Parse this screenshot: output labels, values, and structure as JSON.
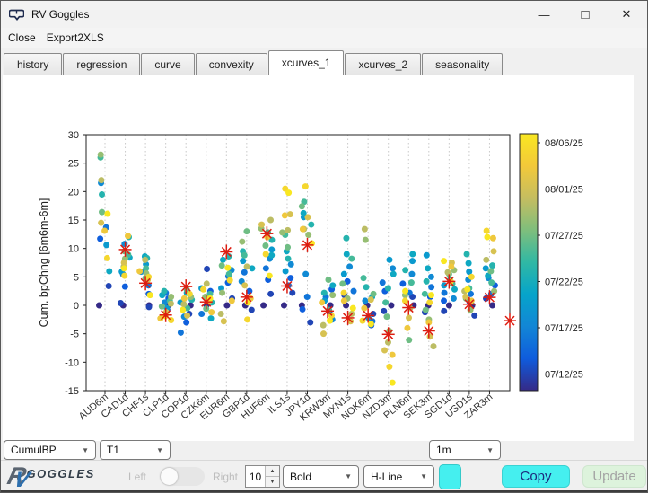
{
  "window": {
    "title": "RV Goggles",
    "controls": {
      "minimize": "—",
      "maximize": "□",
      "close": "✕"
    }
  },
  "menu": {
    "items": [
      {
        "label": "Close"
      },
      {
        "label": "Export2XLS"
      }
    ]
  },
  "tabs": {
    "selected": "xcurves_1",
    "items": [
      {
        "label": "history"
      },
      {
        "label": "regression"
      },
      {
        "label": "curve"
      },
      {
        "label": "convexity"
      },
      {
        "label": "xcurves_1"
      },
      {
        "label": "xcurves_2"
      },
      {
        "label": "seasonality"
      }
    ]
  },
  "chart_data": {
    "type": "scatter",
    "ylabel": "Cum. bpChng [6m6m-6m]",
    "ylim": [
      -15,
      30
    ],
    "yticks": [
      -15,
      -10,
      -5,
      0,
      5,
      10,
      15,
      20,
      25,
      30
    ],
    "grid": "vertical-dotted",
    "categories": [
      "AUD6m",
      "CAD1d",
      "CHF1s",
      "CLP1d",
      "COP1d",
      "CZK6m",
      "EUR6m",
      "GBP1d",
      "HUF6m",
      "ILS1s",
      "JPY1d",
      "KRW3m",
      "MXN1s",
      "NOK6m",
      "NZD3m",
      "PLN6m",
      "SEK3m",
      "SGD1d",
      "USD1s",
      "ZAR3m"
    ],
    "colorbar": {
      "tick_labels": [
        "08/06/25",
        "08/01/25",
        "07/27/25",
        "07/22/25",
        "07/17/25",
        "07/12/25"
      ],
      "colormap": "parula",
      "top_color": "#f9e721",
      "bottom_color": "#352a87"
    },
    "series_note": "values per category are chronological 07/12/25 (dark blue) to 08/06/25 (yellow)",
    "series": [
      {
        "name": "AUD6m",
        "values": [
          0,
          3.4,
          11.7,
          13.7,
          21.5,
          10.6,
          6.0,
          19.5,
          26.0,
          16.4,
          26.5,
          22.0,
          14.5,
          13.1,
          8.3,
          16.1
        ]
      },
      {
        "name": "CAD1d",
        "values": [
          0,
          0.4,
          3.3,
          5.4,
          10.8,
          5.9,
          8.4,
          12.0,
          8.9,
          9.5,
          8.2,
          6.8,
          7.5,
          12.2,
          5.2,
          6.5
        ]
      },
      {
        "name": "CHF1s",
        "values": [
          0,
          -0.3,
          2.0,
          3.5,
          5.9,
          7.2,
          8.6,
          8.3,
          6.5,
          4.8,
          5.6,
          8.0,
          4.5,
          6.0,
          5.0,
          1.8
        ]
      },
      {
        "name": "CLP1d",
        "values": [
          0,
          -0.8,
          1.2,
          2.2,
          0.5,
          -0.5,
          1.8,
          2.5,
          0.8,
          -0.2,
          1.5,
          0.3,
          -1.2,
          -2.3,
          -2.6,
          -1.9
        ]
      },
      {
        "name": "COP1d",
        "values": [
          0,
          -1.5,
          -3.0,
          -4.8,
          -2.0,
          0.5,
          2.2,
          1.0,
          -0.5,
          2.8,
          1.5,
          0.2,
          -1.8,
          1.2,
          2.0,
          -0.8
        ]
      },
      {
        "name": "CZK6m",
        "values": [
          0,
          6.4,
          2.5,
          -1.5,
          1.0,
          3.0,
          -2.3,
          0.5,
          2.0,
          -0.6,
          1.5,
          3.8,
          0.8,
          -1.2,
          2.8,
          1.2
        ]
      },
      {
        "name": "EUR6m",
        "values": [
          0,
          1.2,
          4.0,
          5.1,
          6.2,
          3.0,
          8.0,
          8.6,
          5.5,
          7.0,
          2.2,
          -1.5,
          -2.8,
          0.8,
          4.4,
          6.6
        ]
      },
      {
        "name": "GBP1d",
        "values": [
          0,
          -0.8,
          2.5,
          5.8,
          4.2,
          7.8,
          6.5,
          9.5,
          8.8,
          13.0,
          11.2,
          6.8,
          3.5,
          1.2,
          -2.5,
          0.5
        ]
      },
      {
        "name": "HUF6m",
        "values": [
          0,
          2.0,
          4.5,
          6.5,
          8.2,
          9.8,
          8.8,
          11.5,
          12.8,
          10.5,
          13.5,
          15.0,
          14.2,
          12.0,
          9.0,
          5.2
        ]
      },
      {
        "name": "ILS1s",
        "values": [
          0,
          2.2,
          4.8,
          3.5,
          7.2,
          6.0,
          9.5,
          8.2,
          12.4,
          10.2,
          12.8,
          13.2,
          16.0,
          15.8,
          20.5,
          19.8
        ]
      },
      {
        "name": "JPY1d",
        "values": [
          0,
          -3.0,
          -0.7,
          1.5,
          5.5,
          15.5,
          16.2,
          14.2,
          18.2,
          17.4,
          12.4,
          13.4,
          15.5,
          13.4,
          20.9,
          10.9
        ]
      },
      {
        "name": "KRW3m",
        "values": [
          0,
          -1.2,
          2.8,
          1.5,
          -2.5,
          0.8,
          3.5,
          2.2,
          -0.8,
          4.5,
          1.8,
          -3.5,
          -5.0,
          0.5,
          -1.8,
          -2.7
        ]
      },
      {
        "name": "MXN1s",
        "values": [
          0,
          1.8,
          4.2,
          2.5,
          6.8,
          5.5,
          9.0,
          11.8,
          8.2,
          3.8,
          1.2,
          -1.5,
          -2.8,
          0.8,
          2.2,
          -0.5
        ]
      },
      {
        "name": "NOK6m",
        "values": [
          0,
          -1.5,
          -3.5,
          -2.8,
          0.8,
          -2.2,
          1.5,
          3.2,
          4.8,
          2.0,
          11.5,
          13.4,
          1.0,
          -0.5,
          -2.7,
          -3.3
        ]
      },
      {
        "name": "NZD3m",
        "values": [
          0,
          -1.0,
          2.5,
          4.0,
          6.5,
          8.0,
          5.5,
          3.0,
          0.5,
          -2.0,
          -4.5,
          -6.5,
          -7.9,
          -8.7,
          -10.8,
          -13.6
        ]
      },
      {
        "name": "PLN6m",
        "values": [
          0,
          1.5,
          3.8,
          2.2,
          5.5,
          7.8,
          9.0,
          6.2,
          4.0,
          -6.1,
          1.8,
          -0.5,
          -2.2,
          -4.0,
          0.8,
          2.5
        ]
      },
      {
        "name": "SEK3m",
        "values": [
          0,
          -1.2,
          1.5,
          3.2,
          5.0,
          8.8,
          6.5,
          4.2,
          2.0,
          -0.8,
          -2.5,
          -7.2,
          -5.5,
          -3.0,
          0.5,
          1.8
        ]
      },
      {
        "name": "SGD1d",
        "values": [
          0,
          -1.0,
          0.8,
          2.2,
          1.2,
          3.5,
          2.8,
          4.5,
          3.8,
          5.5,
          6.2,
          5.8,
          7.5,
          6.8,
          4.2,
          7.8
        ]
      },
      {
        "name": "USD1s",
        "values": [
          0,
          -1.8,
          0.5,
          2.0,
          4.5,
          5.9,
          7.4,
          9.0,
          3.0,
          1.2,
          -0.8,
          2.5,
          1.5,
          0.8,
          5.0,
          2.8
        ]
      },
      {
        "name": "ZAR3m",
        "values": [
          0,
          1.2,
          3.5,
          2.0,
          4.8,
          6.5,
          5.2,
          7.0,
          4.0,
          6.0,
          2.5,
          8.0,
          9.5,
          11.8,
          13.1,
          12.0
        ]
      }
    ],
    "star_markers": {
      "color": "#dd1c10",
      "points": [
        {
          "x_index": 1,
          "value": 9.8
        },
        {
          "x_index": 2,
          "value": 3.9
        },
        {
          "x_index": 3,
          "value": -1.7
        },
        {
          "x_index": 4,
          "value": 3.3
        },
        {
          "x_index": 5,
          "value": 0.6
        },
        {
          "x_index": 6,
          "value": 9.4
        },
        {
          "x_index": 7,
          "value": 1.45
        },
        {
          "x_index": 8,
          "value": 12.6
        },
        {
          "x_index": 9,
          "value": 3.4
        },
        {
          "x_index": 10,
          "value": 10.6
        },
        {
          "x_index": 11,
          "value": -1.0
        },
        {
          "x_index": 12,
          "value": -2.2
        },
        {
          "x_index": 13,
          "value": -1.8
        },
        {
          "x_index": 14,
          "value": -5.1
        },
        {
          "x_index": 15,
          "value": -0.4
        },
        {
          "x_index": 16,
          "value": -4.5
        },
        {
          "x_index": 17,
          "value": 4.2
        },
        {
          "x_index": 18,
          "value": 0.2
        },
        {
          "x_index": 19,
          "value": 1.4
        },
        {
          "x_index": 20,
          "value": -2.7
        }
      ]
    }
  },
  "controls": {
    "series_select": "CumulBP",
    "t_select": "T1",
    "tenor_select": "1m"
  },
  "toolbar": {
    "logo_r": "R",
    "logo_v": "V",
    "logo_text": "GOGGLES",
    "left_label": "Left",
    "right_label": "Right",
    "font_size": "10",
    "font_weight": "Bold",
    "line_style": "H-Line",
    "copy_label": "Copy",
    "update_label": "Update",
    "accent_cyan": "#45efef",
    "update_green": "#ddf3dc"
  }
}
